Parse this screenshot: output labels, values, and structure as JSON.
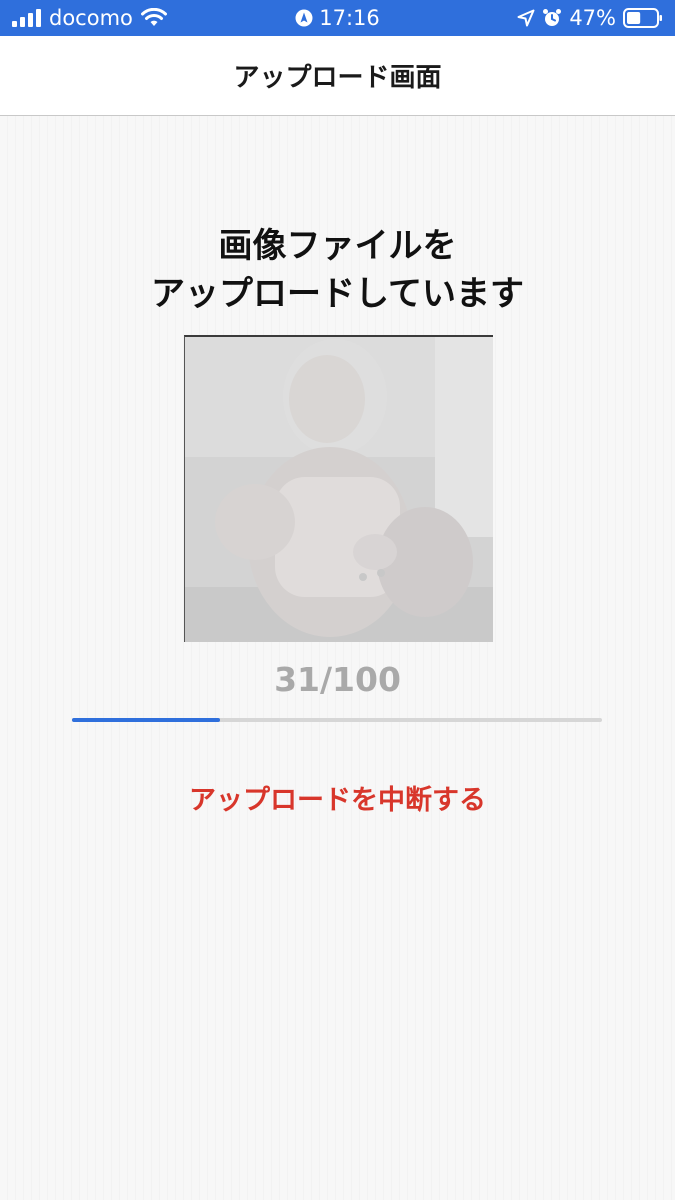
{
  "status_bar": {
    "carrier": "docomo",
    "time": "17:16",
    "battery_percent": "47%",
    "battery_level": 0.47,
    "icons": [
      "signal-icon",
      "wifi-icon",
      "navigation-icon",
      "location-arrow-icon",
      "alarm-icon",
      "battery-icon"
    ]
  },
  "nav": {
    "title": "アップロード画面"
  },
  "main": {
    "heading_line1": "画像ファイルを",
    "heading_line2": "アップロードしています",
    "progress_text": "31/100",
    "progress_fraction": 0.28,
    "cancel_label": "アップロードを中断する"
  },
  "colors": {
    "accent": "#2f6fdc",
    "cancel": "#d8362b",
    "counter": "#a9a9a9"
  }
}
